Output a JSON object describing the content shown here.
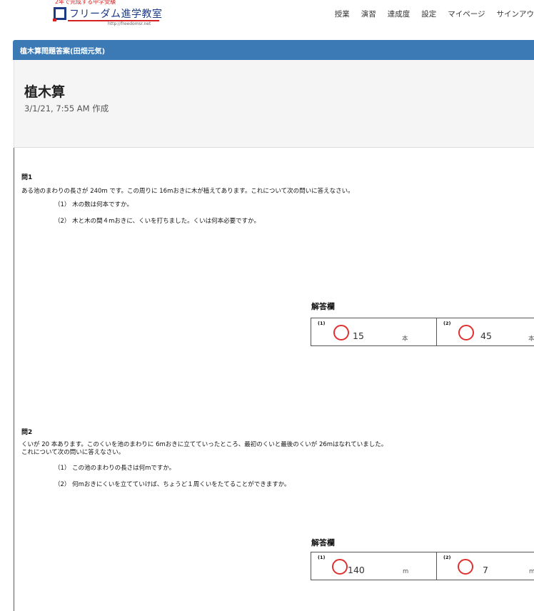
{
  "header": {
    "logo_tagline": "2年で完成する中学受験",
    "logo_name": "フリーダム進学教室",
    "logo_url": "http://freedomsr.net",
    "nav": [
      "授業",
      "演習",
      "達成度",
      "設定",
      "マイページ",
      "サインアウ"
    ]
  },
  "titlebar": {
    "label": "植木算問題答案(田畑元気)"
  },
  "page": {
    "title": "植木算",
    "created": "3/1/21, 7:55 AM 作成"
  },
  "questions": [
    {
      "label": "問1",
      "text": [
        "ある池のまわりの長さが 240m です。この周りに 16mおきに木が植えてあります。これについて次の問いに答えなさい。"
      ],
      "subs": [
        "（1） 木の数は何本ですか。",
        "（2） 木と木の間４mおきに、くいを打ちました。くいは何本必要ですか。"
      ],
      "answer_title": "解答欄",
      "answers": [
        {
          "num": "(1)",
          "value": "15",
          "unit": "本"
        },
        {
          "num": "(2)",
          "value": "45",
          "unit": "本"
        }
      ]
    },
    {
      "label": "問2",
      "text": [
        "くいが 20 本あります。このくいを池のまわりに 6mおきに立てていったところ、最初のくいと最後のくいが 26mはなれていました。",
        "これについて次の問いに答えなさい。"
      ],
      "subs": [
        "（1） この池のまわりの長さは何mですか。",
        "（2） 何mおきにくいを立てていけば、ちょうど１周くいをたてることができますか。"
      ],
      "answer_title": "解答欄",
      "answers": [
        {
          "num": "(1)",
          "value": "140",
          "unit": "m"
        },
        {
          "num": "(2)",
          "value": "7",
          "unit": "m"
        }
      ]
    }
  ],
  "colors": {
    "accent": "#3c7ab6",
    "brand_blue": "#1d3a86",
    "brand_red": "#d42020",
    "correct_mark": "#e03030"
  }
}
